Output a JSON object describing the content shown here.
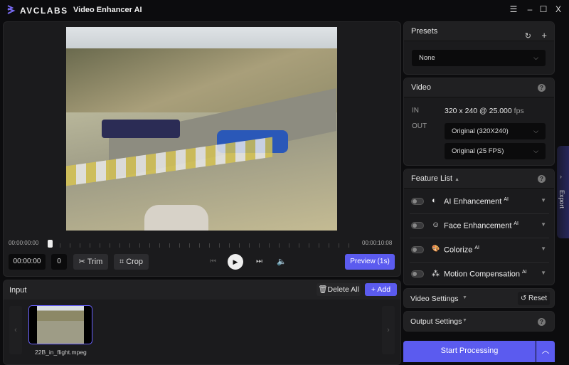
{
  "app": {
    "brand": "AVCLABS",
    "title": "Video Enhancer AI"
  },
  "window": {
    "menu": "☰",
    "minimize": "–",
    "maximize": "☐",
    "close": "X"
  },
  "player": {
    "time_start": "00:00:00:00",
    "time_end": "00:00:10:08",
    "current_time": "00:00:00",
    "frame": "0",
    "trim": "Trim",
    "crop": "Crop",
    "preview": "Preview (1s)",
    "progress": 0
  },
  "input": {
    "title": "Input",
    "delete_all": "Delete All",
    "add": "+ Add",
    "files": [
      {
        "name": "22B_in_flight.mpeg"
      }
    ]
  },
  "presets": {
    "title": "Presets",
    "selected": "None"
  },
  "video": {
    "title": "Video",
    "in_label": "IN",
    "in_value": "320 x 240 @ 25.000",
    "in_unit": "fps",
    "out_label": "OUT",
    "out_resolution": "Original (320X240)",
    "out_fps": "Original (25 FPS)"
  },
  "features": {
    "title": "Feature List",
    "items": [
      {
        "label": "AI Enhancement",
        "badge": "AI",
        "icon": "◐"
      },
      {
        "label": "Face Enhancement",
        "badge": "AI",
        "icon": "☺"
      },
      {
        "label": "Colorize",
        "badge": "AI",
        "icon": "🎨"
      },
      {
        "label": "Motion Compensation",
        "badge": "AI",
        "icon": "⁂"
      }
    ]
  },
  "video_settings": {
    "title": "Video Settings",
    "reset": "Reset"
  },
  "output_settings": {
    "title": "Output Settings"
  },
  "start": {
    "label": "Start Processing"
  },
  "export_tab": {
    "label": "Export"
  },
  "colors": {
    "accent": "#5b5bef",
    "bg": "#0c0c0e",
    "panel": "#1b1b1d"
  }
}
